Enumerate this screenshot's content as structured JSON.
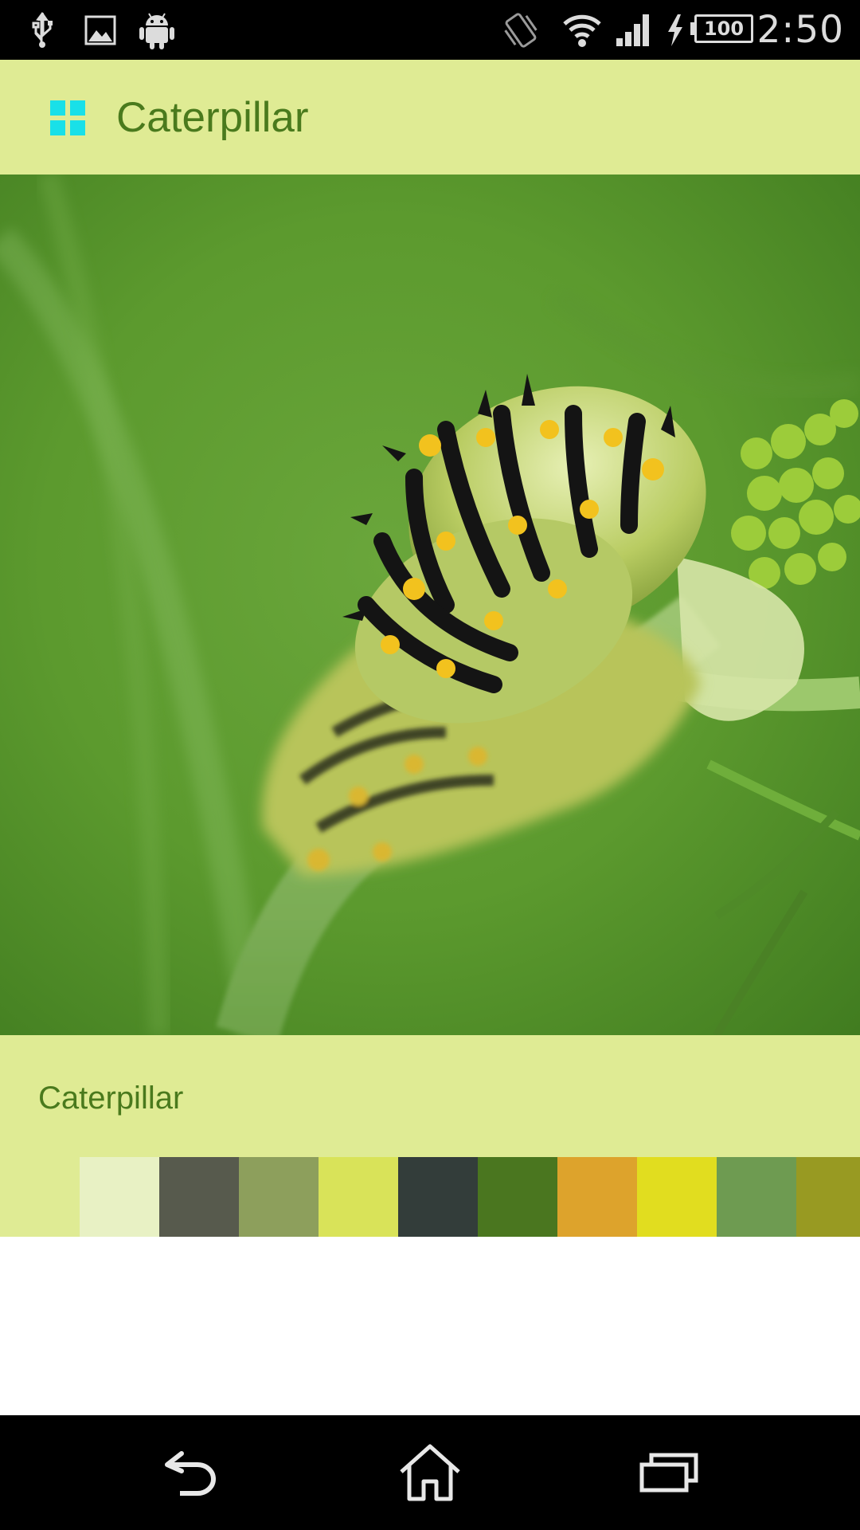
{
  "status_bar": {
    "time": "2:50",
    "battery_level": "100",
    "icons": [
      "usb-icon",
      "image-icon",
      "android-icon",
      "vibrate-icon",
      "wifi-icon",
      "signal-icon",
      "charging-icon",
      "battery-icon"
    ]
  },
  "action_bar": {
    "title": "Caterpillar",
    "app_icon": "grid-icon",
    "app_icon_color": "#19e0e8"
  },
  "photo": {
    "subject": "caterpillar-photo"
  },
  "panel": {
    "title": "Caterpillar",
    "background": "#dfeb94",
    "swatches": [
      "#e8f1c4",
      "#575a4d",
      "#8d9f5c",
      "#d9e359",
      "#333d3a",
      "#4a761f",
      "#dda32c",
      "#e1dd1f",
      "#6e9b51",
      "#989a22"
    ]
  },
  "nav_bar": {
    "buttons": [
      "back-icon",
      "home-icon",
      "recents-icon"
    ]
  }
}
